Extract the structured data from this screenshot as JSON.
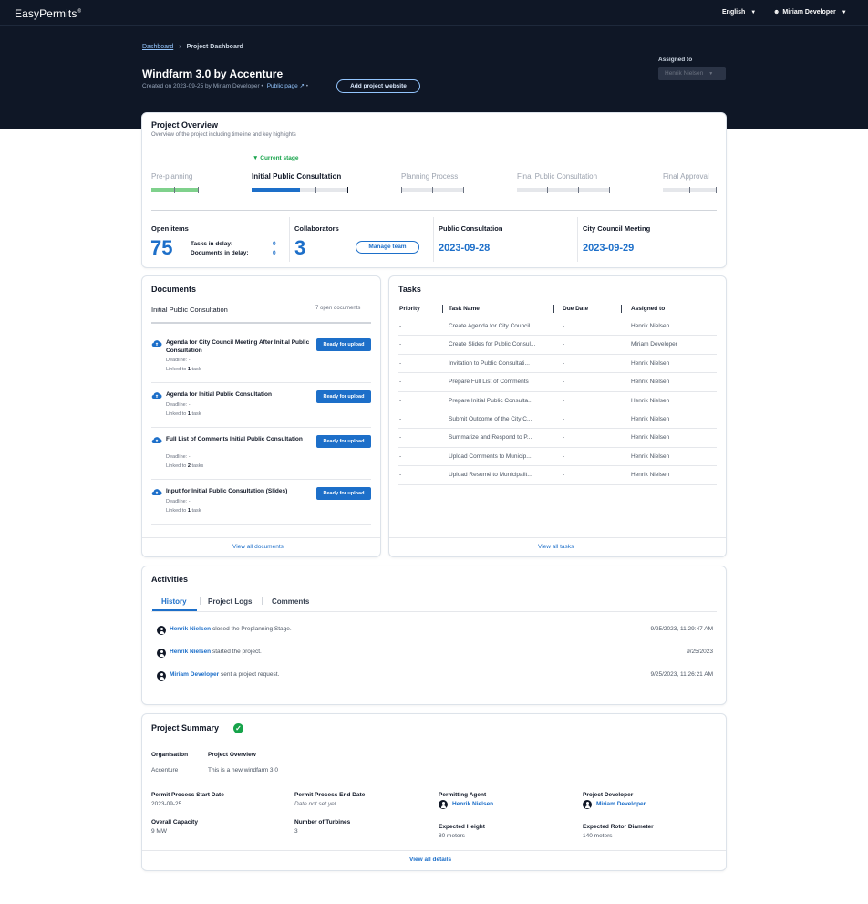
{
  "app": {
    "logo": "EasyPermits",
    "logo_mark": "®",
    "language": "English",
    "user": "Miriam Developer"
  },
  "header": {
    "breadcrumb": [
      "Dashboard",
      "Project Dashboard"
    ],
    "title": "Windfarm 3.0 by Accenture",
    "created": "Created on 2023-09-25 by Miriam Developer",
    "public_page": "Public page",
    "add_website": "Add project website",
    "assigned_label": "Assigned to",
    "assigned_value": "Henrik Nielsen"
  },
  "overview": {
    "title": "Project Overview",
    "subtitle": "Overview of the project including timeline and key highlights",
    "current_stage_label": "Current stage",
    "stages": [
      {
        "name": "Pre-planning",
        "progress": 1.0
      },
      {
        "name": "Initial Public Consultation",
        "progress": 0.5
      },
      {
        "name": "Planning Process",
        "progress": 0
      },
      {
        "name": "Final Public Consultation",
        "progress": 0
      },
      {
        "name": "Final Approval",
        "progress": 0
      }
    ],
    "open_items_label": "Open items",
    "open_items": "75",
    "tasks_delay_label": "Tasks in delay:",
    "tasks_delay": "0",
    "docs_delay_label": "Documents in delay:",
    "docs_delay": "0",
    "collaborators_label": "Collaborators",
    "collaborators": "3",
    "manage_team": "Manage team",
    "public_consultation_label": "Public Consultation",
    "public_consultation_date": "2023-09-28",
    "council_label": "City Council Meeting",
    "council_date": "2023-09-29"
  },
  "documents": {
    "title": "Documents",
    "stage": "Initial Public Consultation",
    "open_count": "7 open documents",
    "deadline_label": "Deadline: -",
    "linked_prefix": "Linked to",
    "ready_label": "Ready for upload",
    "items": [
      {
        "title": "Agenda for City Council Meeting After Initial Public Consultation",
        "linked": "1",
        "unit": "task"
      },
      {
        "title": "Agenda for Initial Public Consultation",
        "linked": "1",
        "unit": "task"
      },
      {
        "title": "Full List of Comments Initial Public Consultation",
        "linked": "2",
        "unit": "tasks"
      },
      {
        "title": "Input for Initial Public Consultation (Slides)",
        "linked": "1",
        "unit": "task"
      }
    ],
    "view_all": "View all documents"
  },
  "tasks": {
    "title": "Tasks",
    "columns": [
      "Priority",
      "Task Name",
      "Due Date",
      "Assigned to"
    ],
    "rows": [
      [
        "-",
        "Create Agenda for City Council...",
        "-",
        "Henrik Nielsen"
      ],
      [
        "-",
        "Create Slides for Public Consul...",
        "-",
        "Miriam Developer"
      ],
      [
        "-",
        "Invitation to Public Consultati...",
        "-",
        "Henrik Nielsen"
      ],
      [
        "-",
        "Prepare Full List of Comments",
        "-",
        "Henrik Nielsen"
      ],
      [
        "-",
        "Prepare Initial Public Consulta...",
        "-",
        "Henrik Nielsen"
      ],
      [
        "-",
        "Submit Outcome of the City C...",
        "-",
        "Henrik Nielsen"
      ],
      [
        "-",
        "Summarize and Respond to P...",
        "-",
        "Henrik Nielsen"
      ],
      [
        "-",
        "Upload Comments to Municip...",
        "-",
        "Henrik Nielsen"
      ],
      [
        "-",
        "Upload Resumé to Municipalit...",
        "-",
        "Henrik Nielsen"
      ]
    ],
    "view_all": "View all tasks"
  },
  "activities": {
    "title": "Activities",
    "tabs": [
      "History",
      "Project Logs",
      "Comments"
    ],
    "items": [
      {
        "who": "Henrik Nielsen",
        "what": "closed the Preplanning Stage.",
        "when": "9/25/2023, 11:29:47 AM"
      },
      {
        "who": "Henrik Nielsen",
        "what": "started the project.",
        "when": "9/25/2023"
      },
      {
        "who": "Miriam Developer",
        "what": "sent a project request.",
        "when": "9/25/2023, 11:26:21 AM"
      }
    ]
  },
  "summary": {
    "title": "Project Summary",
    "organisation_label": "Organisation",
    "organisation": "Accenture",
    "overview_label": "Project Overview",
    "overview": "This is a new windfarm 3.0",
    "start_label": "Permit Process Start Date",
    "start": "2023-09-25",
    "end_label": "Permit Process End Date",
    "end": "Date not set yet",
    "agent_label": "Permitting Agent",
    "agent": "Henrik Nielsen",
    "developer_label": "Project Developer",
    "developer": "Miriam Developer",
    "capacity_label": "Overall Capacity",
    "capacity": "9 MW",
    "turbines_label": "Number of Turbines",
    "turbines": "3",
    "height_label": "Expected Height",
    "height": "80 meters",
    "rotor_label": "Expected Rotor Diameter",
    "rotor": "140 meters",
    "view_all": "View all details"
  },
  "colors": {
    "header_bg": "#0f1726",
    "accent": "#1d6fc9",
    "done": "#7fd18c",
    "success": "#16a34a"
  }
}
